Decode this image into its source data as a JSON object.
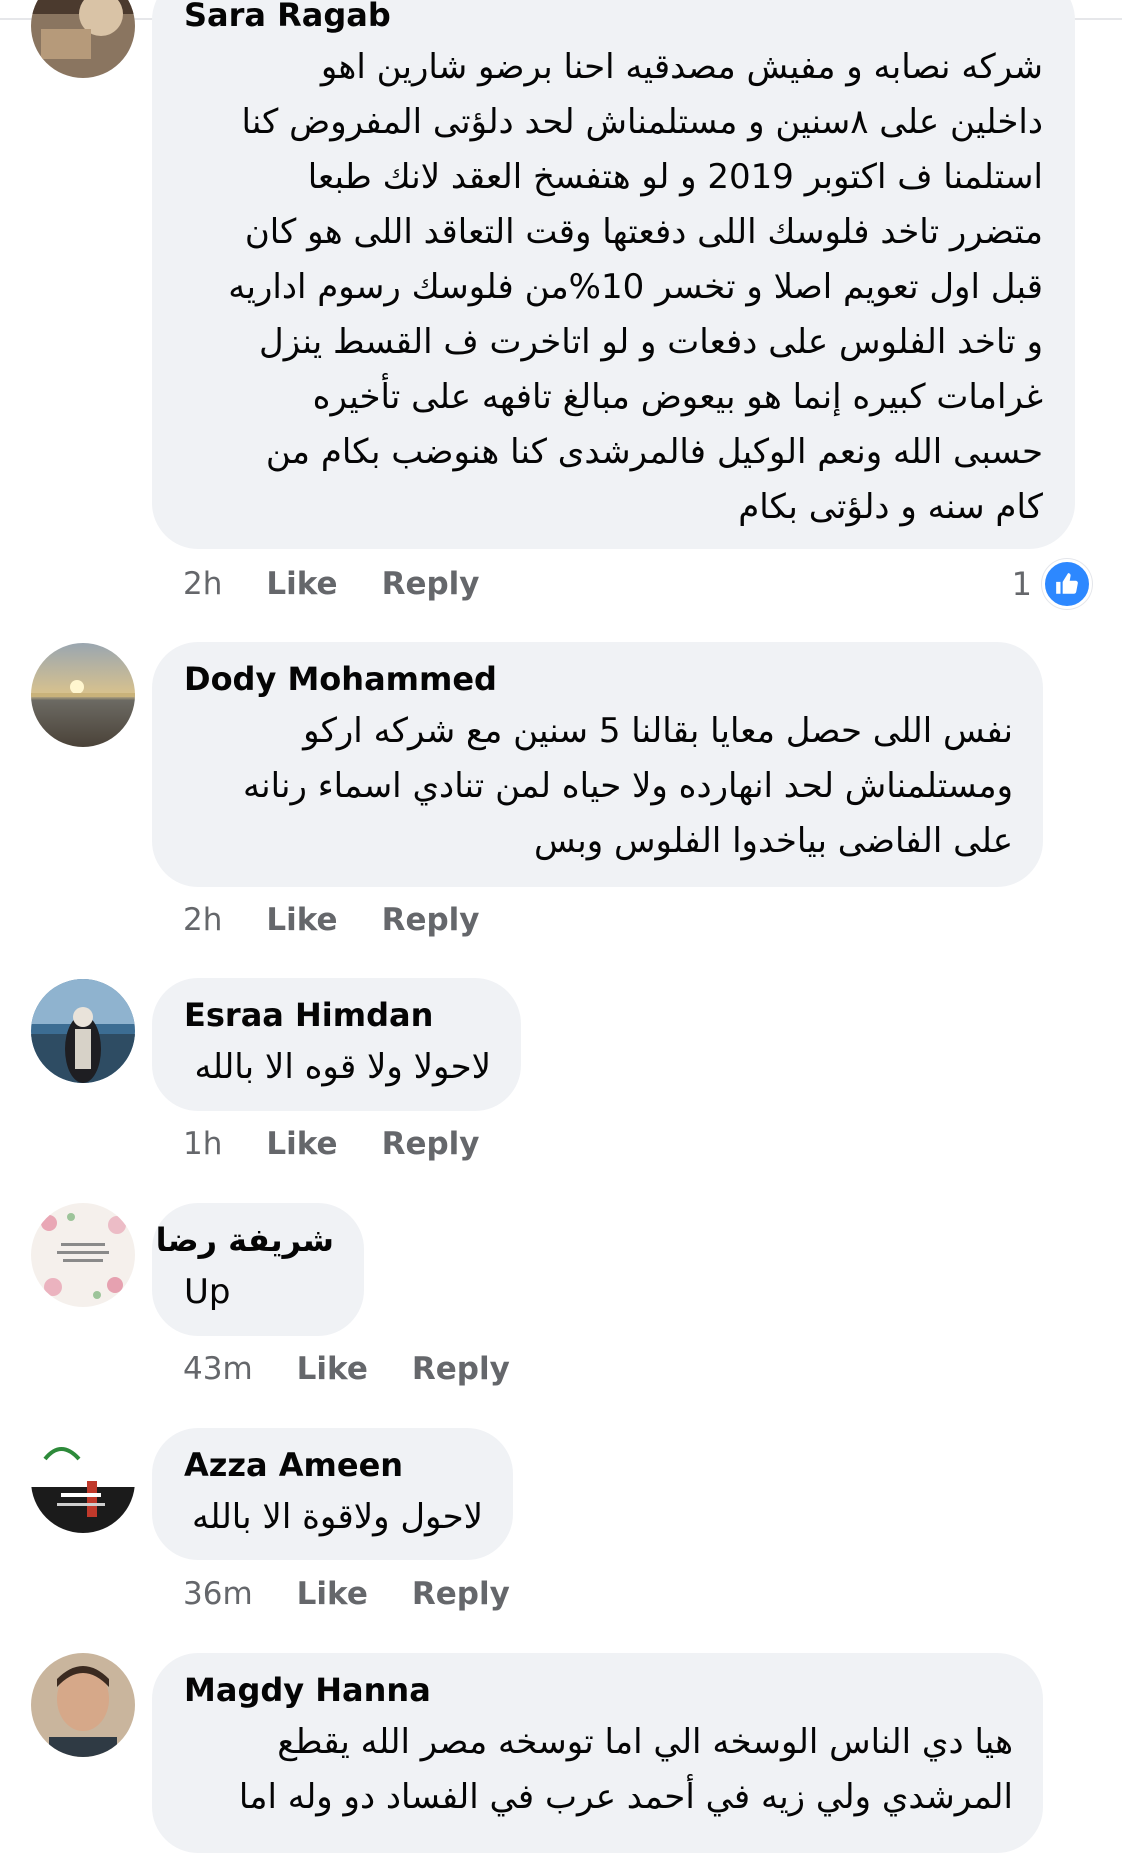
{
  "comments": [
    {
      "author": "Sara Ragab",
      "lines": [
        "شركه نصابه و مفيش مصدقيه احنا برضو شارين اهو",
        "داخلين على ٨سنين و مستلمناش لحد دلؤتى المفروض كنا",
        "استلمنا ف اكتوبر 2019 و لو هتفسخ العقد لانك طبعا",
        "متضرر تاخد فلوسك اللى دفعتها وقت التعاقد اللى هو كان",
        "قبل اول تعويم اصلا و تخسر 10%من فلوسك رسوم اداريه",
        "و تاخد الفلوس على دفعات و لو اتاخرت ف القسط ينزل",
        "غرامات كبيره إنما هو بيعوض مبالغ تافهه على تأخيره",
        "حسبى الله ونعم الوكيل فالمرشدى كنا هنوضب بكام من",
        "كام سنه و دلؤتى بكام"
      ],
      "time": "2h",
      "like": "Like",
      "reply": "Reply",
      "reaction_count": "1"
    },
    {
      "author": "Dody Mohammed",
      "lines": [
        "نفس اللى حصل معايا بقالنا 5 سنين مع شركه اركو",
        "ومستلمناش لحد انهارده ولا حياه لمن تنادي اسماء رنانه",
        "على الفاضى بياخدوا الفلوس وبس"
      ],
      "time": "2h",
      "like": "Like",
      "reply": "Reply"
    },
    {
      "author": "Esraa Himdan",
      "lines": [
        "لاحولا ولا قوه الا بالله"
      ],
      "time": "1h",
      "like": "Like",
      "reply": "Reply"
    },
    {
      "author": "شريفة رضا",
      "lines": [
        "Up"
      ],
      "time": "43m",
      "like": "Like",
      "reply": "Reply"
    },
    {
      "author": "Azza Ameen",
      "lines": [
        "لاحول ولاقوة الا بالله"
      ],
      "time": "36m",
      "like": "Like",
      "reply": "Reply"
    },
    {
      "author": "Magdy Hanna",
      "lines": [
        "هيا دي الناس الوسخه الي اما توسخه مصر الله يقطع",
        "المرشدي ولي زيه في أحمد عرب في الفساد دو وله اما"
      ]
    }
  ],
  "icons": {
    "like_badge": "thumbs-up-icon"
  },
  "colors": {
    "bubble": "#f0f2f5",
    "meta": "#65676b",
    "like_blue": "#2d88ff"
  }
}
